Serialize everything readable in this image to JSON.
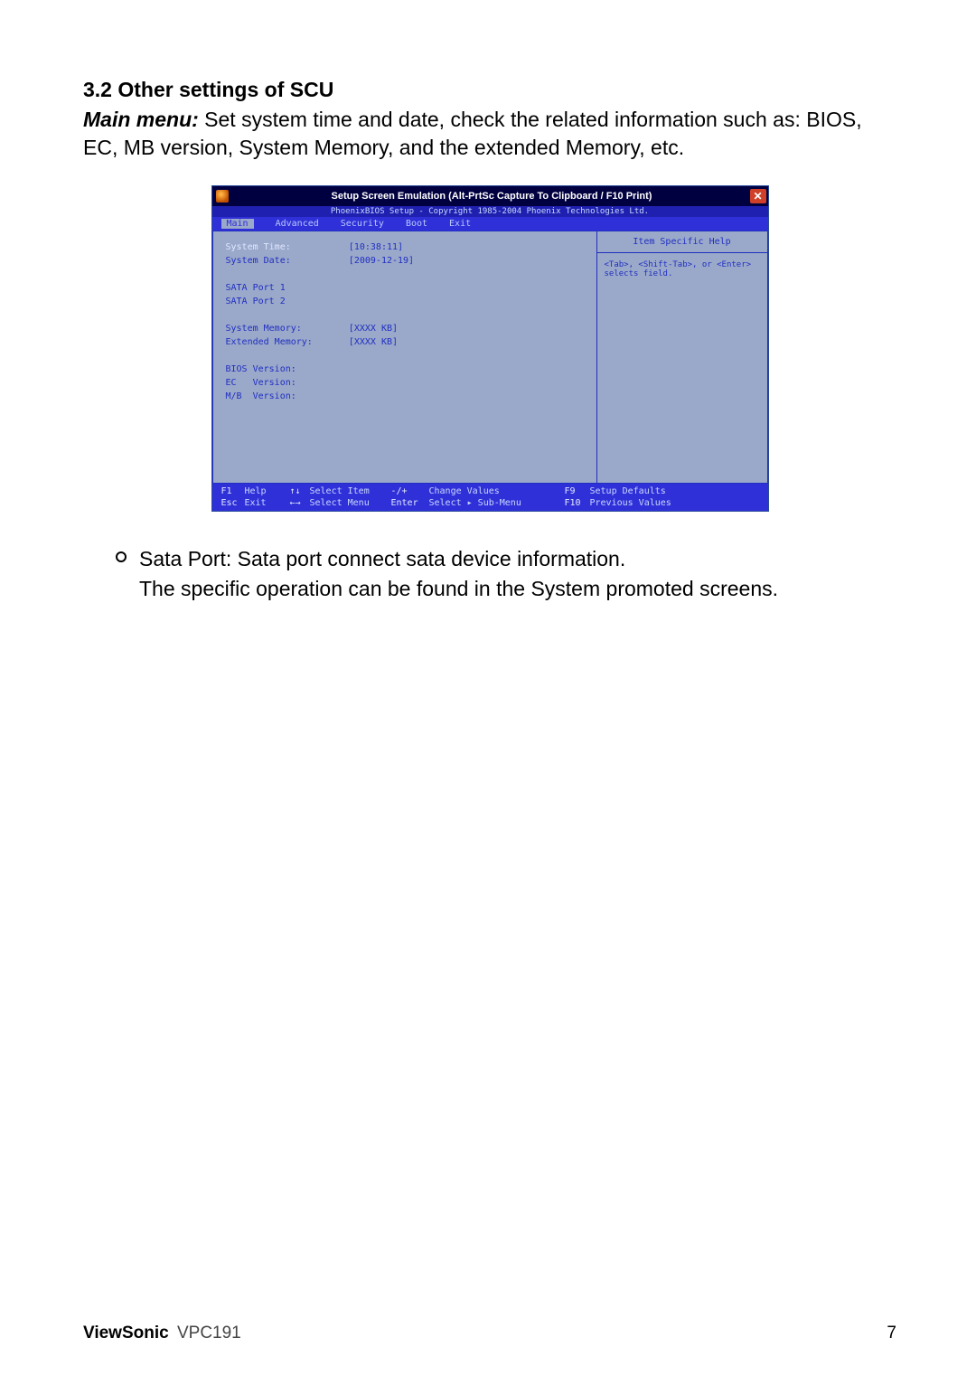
{
  "heading": "3.2 Other settings of SCU",
  "intro": {
    "lead": "Main menu:",
    "rest": " Set system time and date, check the related information such as: BIOS, EC, MB version, System Memory, and the extended Memory, etc."
  },
  "window": {
    "title": "Setup Screen Emulation (Alt-PrtSc Capture To Clipboard / F10 Print)",
    "close_glyph": "✕",
    "copyright": "PhoenixBIOS Setup - Copyright 1985-2004 Phoenix Technologies Ltd.",
    "tabs": [
      "Main",
      "Advanced",
      "Security",
      "Boot",
      "Exit"
    ],
    "rows": {
      "r0": {
        "label": "System Time:",
        "value": "[10:38:11]"
      },
      "r1": {
        "label": "System Date:",
        "value": "[2009-12-19]"
      },
      "r2": {
        "label": " ",
        "value": " "
      },
      "r3": {
        "label": "SATA Port 1",
        "value": " "
      },
      "r4": {
        "label": "SATA Port 2",
        "value": " "
      },
      "r5": {
        "label": " ",
        "value": " "
      },
      "r6": {
        "label": "System Memory:",
        "value": "[XXXX KB]"
      },
      "r7": {
        "label": "Extended Memory:",
        "value": "[XXXX KB]"
      },
      "r8": {
        "label": " ",
        "value": " "
      },
      "r9": {
        "label": "BIOS Version:",
        "value": " "
      },
      "r10": {
        "label": "EC   Version:",
        "value": " "
      },
      "r11": {
        "label": "M/B  Version:",
        "value": " "
      }
    },
    "help": {
      "title": "Item Specific Help",
      "body": "<Tab>, <Shift-Tab>, or <Enter> selects field."
    },
    "footer": {
      "row1": {
        "f": "F1",
        "fl": "Help",
        "a": "↑↓",
        "al": "Select Item",
        "c": "-/+",
        "cl": "Change Values",
        "r": "F9",
        "rl": "Setup Defaults"
      },
      "row2": {
        "f": "Esc",
        "fl": "Exit",
        "a": "←→",
        "al": "Select Menu",
        "c": "Enter",
        "cl": "Select ▸ Sub-Menu",
        "r": "F10",
        "rl": "Previous Values"
      }
    }
  },
  "bullet": {
    "line1": "Sata Port: Sata port connect sata device information.",
    "line2": "The specific operation can be found in the System promoted screens."
  },
  "footer": {
    "brand": "ViewSonic",
    "model": "VPC191",
    "page": "7"
  }
}
